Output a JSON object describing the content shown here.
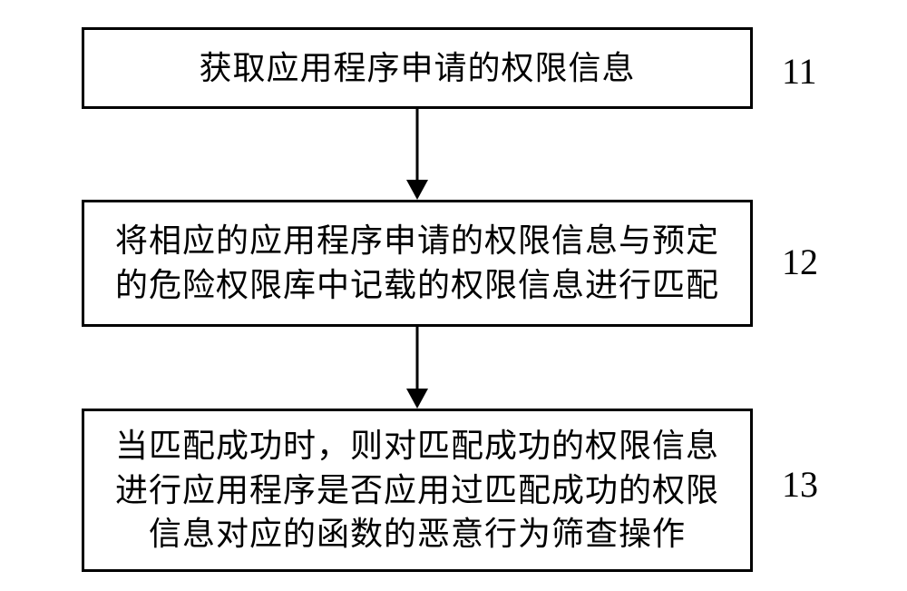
{
  "steps": [
    {
      "label": "11",
      "text": "获取应用程序申请的权限信息"
    },
    {
      "label": "12",
      "text": "将相应的应用程序申请的权限信息与预定的危险权限库中记载的权限信息进行匹配"
    },
    {
      "label": "13",
      "text": "当匹配成功时，则对匹配成功的权限信息进行应用程序是否应用过匹配成功的权限信息对应的函数的恶意行为筛查操作"
    }
  ]
}
